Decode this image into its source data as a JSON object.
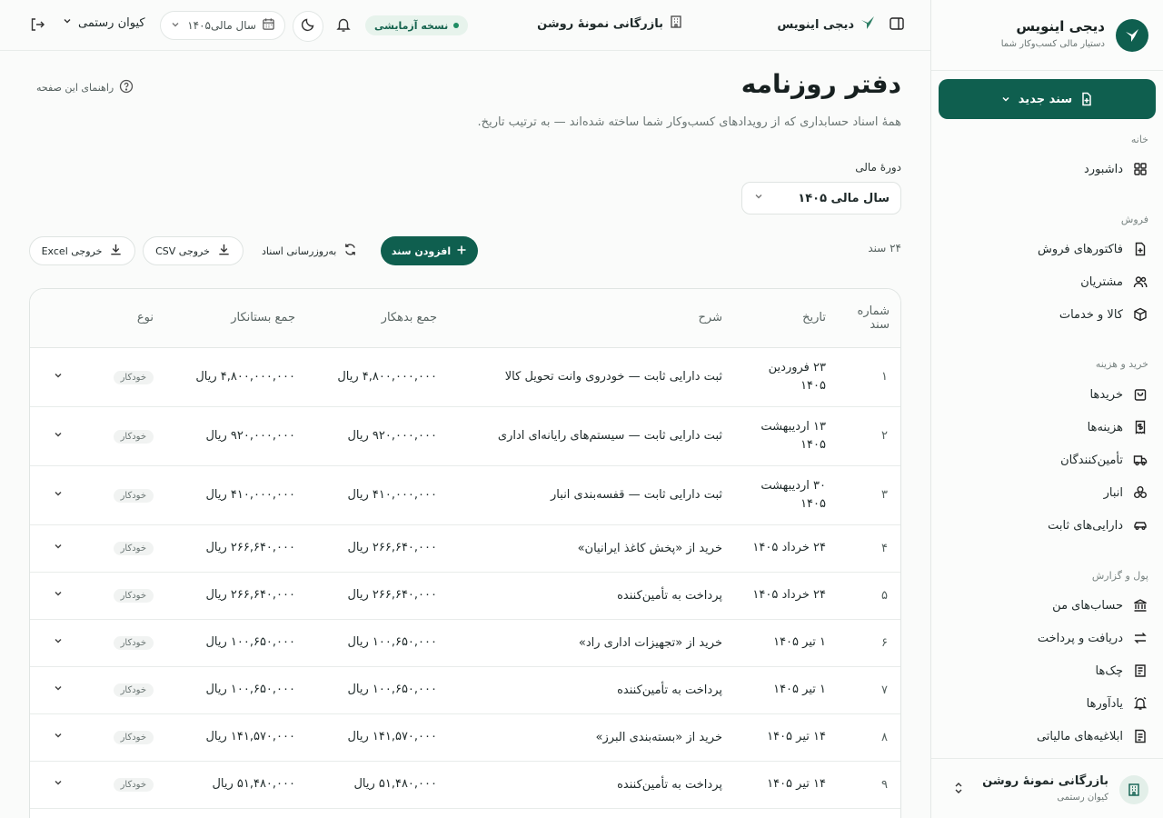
{
  "sidebar": {
    "brand_title": "دیجی اینویس",
    "brand_subtitle": "دستیار مالی کسب‌وکار شما",
    "new_doc_label": "سند جدید",
    "groups": [
      {
        "title": "خانه",
        "items": [
          {
            "label": "داشبورد",
            "icon": "dashboard-icon"
          }
        ]
      },
      {
        "title": "فروش",
        "items": [
          {
            "label": "فاکتورهای فروش",
            "icon": "invoice-icon"
          },
          {
            "label": "مشتریان",
            "icon": "users-icon"
          },
          {
            "label": "کالا و خدمات",
            "icon": "box-icon"
          }
        ]
      },
      {
        "title": "خرید و هزینه",
        "items": [
          {
            "label": "خریدها",
            "icon": "bag-icon"
          },
          {
            "label": "هزینه‌ها",
            "icon": "receipt-icon"
          },
          {
            "label": "تأمین‌کنندگان",
            "icon": "truck-icon"
          },
          {
            "label": "انبار",
            "icon": "boxes-icon"
          },
          {
            "label": "دارایی‌های ثابت",
            "icon": "car-icon"
          }
        ]
      },
      {
        "title": "پول و گزارش",
        "items": [
          {
            "label": "حساب‌های من",
            "icon": "bank-icon"
          },
          {
            "label": "دریافت و پرداخت",
            "icon": "transfer-icon"
          },
          {
            "label": "چک‌ها",
            "icon": "cheque-icon"
          },
          {
            "label": "یادآورها",
            "icon": "alarm-icon"
          },
          {
            "label": "ابلاغیه‌های مالیاتی",
            "icon": "tax-notice-icon"
          }
        ]
      }
    ],
    "account_name": "بازرگانی نمونهٔ روشن",
    "account_user": "کیوان رستمی"
  },
  "topbar": {
    "brand": "دیجی اینویس",
    "company": "بازرگانی نمونهٔ روشن",
    "trial_badge": "نسخه آزمایشی",
    "fiscal_year": "سال مالی۱۴۰۵",
    "user_name": "کیوان رستمی"
  },
  "page": {
    "title": "دفتر روزنامه",
    "description": "همهٔ اسناد حسابداری که از رویدادهای کسب‌وکار شما ساخته شده‌اند — به ترتیب تاریخ.",
    "help_link": "راهنمای این صفحه",
    "period_label": "دورهٔ مالی",
    "period_value": "سال مالی ۱۴۰۵",
    "doc_count": "۲۴ سند",
    "add_button": "افزودن سند",
    "refresh_button": "به‌روزرسانی اسناد",
    "csv_button": "خروجی CSV",
    "excel_button": "خروجی Excel"
  },
  "table": {
    "headers": {
      "number_line1": "شماره",
      "number_line2": "سند",
      "date": "تاریخ",
      "description": "شرح",
      "debit": "جمع بدهکار",
      "credit": "جمع بستانکار",
      "type": "نوع"
    },
    "rows": [
      {
        "num": "۱",
        "date": "۲۳ فروردین ۱۴۰۵",
        "desc": "ثبت دارایی ثابت — خودروی وانت تحویل کالا",
        "debit": "۴,۸۰۰,۰۰۰,۰۰۰ ریال",
        "credit": "۴,۸۰۰,۰۰۰,۰۰۰ ریال",
        "type": "خودکار",
        "tall": true
      },
      {
        "num": "۲",
        "date": "۱۳ اردیبهشت ۱۴۰۵",
        "desc": "ثبت دارایی ثابت — سیستم‌های رایانه‌ای اداری",
        "debit": "۹۲۰,۰۰۰,۰۰۰ ریال",
        "credit": "۹۲۰,۰۰۰,۰۰۰ ریال",
        "type": "خودکار",
        "tall": true
      },
      {
        "num": "۳",
        "date": "۳۰ اردیبهشت ۱۴۰۵",
        "desc": "ثبت دارایی ثابت — قفسه‌بندی انبار",
        "debit": "۴۱۰,۰۰۰,۰۰۰ ریال",
        "credit": "۴۱۰,۰۰۰,۰۰۰ ریال",
        "type": "خودکار",
        "tall": true
      },
      {
        "num": "۴",
        "date": "۲۴ خرداد ۱۴۰۵",
        "desc": "خرید از «پخش کاغذ ایرانیان»",
        "debit": "۲۶۶,۶۴۰,۰۰۰ ریال",
        "credit": "۲۶۶,۶۴۰,۰۰۰ ریال",
        "type": "خودکار",
        "tall": false
      },
      {
        "num": "۵",
        "date": "۲۴ خرداد ۱۴۰۵",
        "desc": "پرداخت به تأمین‌کننده",
        "debit": "۲۶۶,۶۴۰,۰۰۰ ریال",
        "credit": "۲۶۶,۶۴۰,۰۰۰ ریال",
        "type": "خودکار",
        "tall": false
      },
      {
        "num": "۶",
        "date": "۱ تیر ۱۴۰۵",
        "desc": "خرید از «تجهیزات اداری راد»",
        "debit": "۱۰۰,۶۵۰,۰۰۰ ریال",
        "credit": "۱۰۰,۶۵۰,۰۰۰ ریال",
        "type": "خودکار",
        "tall": false
      },
      {
        "num": "۷",
        "date": "۱ تیر ۱۴۰۵",
        "desc": "پرداخت به تأمین‌کننده",
        "debit": "۱۰۰,۶۵۰,۰۰۰ ریال",
        "credit": "۱۰۰,۶۵۰,۰۰۰ ریال",
        "type": "خودکار",
        "tall": false
      },
      {
        "num": "۸",
        "date": "۱۴ تیر ۱۴۰۵",
        "desc": "خرید از «بسته‌بندی البرز»",
        "debit": "۱۴۱,۵۷۰,۰۰۰ ریال",
        "credit": "۱۴۱,۵۷۰,۰۰۰ ریال",
        "type": "خودکار",
        "tall": false
      },
      {
        "num": "۹",
        "date": "۱۴ تیر ۱۴۰۵",
        "desc": "پرداخت به تأمین‌کننده",
        "debit": "۵۱,۴۸۰,۰۰۰ ریال",
        "credit": "۵۱,۴۸۰,۰۰۰ ریال",
        "type": "خودکار",
        "tall": false
      }
    ]
  },
  "colors": {
    "accent": "#0f5f4f",
    "trial_badge_bg": "#e7f3ec",
    "trial_badge_text": "#17644f"
  }
}
